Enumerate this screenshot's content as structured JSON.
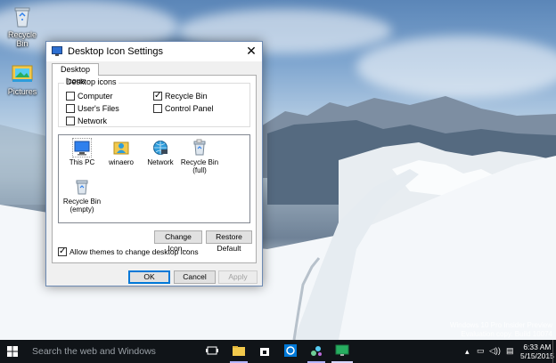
{
  "desktop": {
    "icons": [
      {
        "label": "Recycle Bin"
      },
      {
        "label": "Pictures"
      }
    ],
    "watermark": {
      "line1": "Windows 10 Pro Insider Preview",
      "line2": "Evaluation copy. Build 10074"
    }
  },
  "dialog": {
    "title": "Desktop Icon Settings",
    "close_glyph": "✕",
    "tab_label": "Desktop Icons",
    "group_label": "Desktop icons",
    "checkboxes": [
      {
        "label": "Computer",
        "checked": false
      },
      {
        "label": "Recycle Bin",
        "checked": true
      },
      {
        "label": "User's Files",
        "checked": false
      },
      {
        "label": "Control Panel",
        "checked": false
      },
      {
        "label": "Network",
        "checked": false
      }
    ],
    "icon_list": [
      {
        "label": "This PC",
        "icon": "this-pc-icon"
      },
      {
        "label": "winaero",
        "icon": "user-folder-icon"
      },
      {
        "label": "Network",
        "icon": "network-icon"
      },
      {
        "label": "Recycle Bin (full)",
        "icon": "recycle-bin-full-icon"
      },
      {
        "label": "Recycle Bin (empty)",
        "icon": "recycle-bin-empty-icon"
      }
    ],
    "change_icon_label": "Change Icon...",
    "restore_default_label": "Restore Default",
    "allow_themes": {
      "label": "Allow themes to change desktop icons",
      "checked": true
    },
    "ok_label": "OK",
    "cancel_label": "Cancel",
    "apply_label": "Apply"
  },
  "taskbar": {
    "search_placeholder": "Search the web and Windows",
    "apps": [
      "task-view-icon",
      "file-explorer-icon",
      "store-icon",
      "edge-icon",
      "winaero-app-icon",
      "desktop-icon-settings-app-icon"
    ],
    "time": "6:33 AM",
    "date": "5/15/2015"
  },
  "colors": {
    "accent": "#0078d7",
    "taskbar": "#101418"
  }
}
